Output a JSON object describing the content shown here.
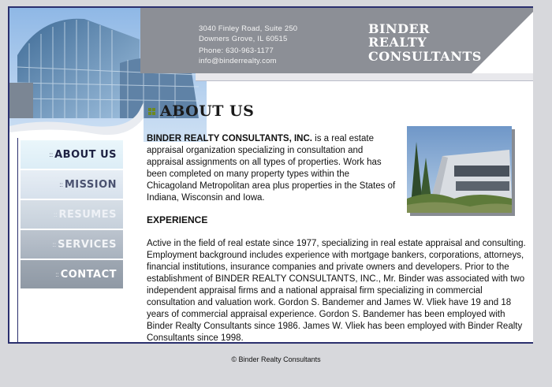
{
  "header": {
    "address_line1": "3040 Finley Road, Suite 250",
    "address_line2": "Downers Grove, IL 60515",
    "phone": "Phone: 630-963-1177",
    "email": "info@binderrealty.com",
    "logo_lines": [
      "BINDER",
      "REALTY",
      "CONSULTANTS"
    ]
  },
  "nav": {
    "items": [
      {
        "label": "ABOUT US"
      },
      {
        "label": "MISSION"
      },
      {
        "label": "RESUMES"
      },
      {
        "label": "SERVICES"
      },
      {
        "label": "CONTACT"
      }
    ],
    "bullet": "::"
  },
  "main": {
    "title": "ABOUT US",
    "intro_company": "BINDER REALTY CONSULTANTS, INC.",
    "intro_text": " is a real estate appraisal organization specializing in consultation and appraisal assignments on all types of properties. Work has been completed on many property types within the Chicagoland Metropolitan area plus properties in the States of Indiana, Wisconsin and Iowa.",
    "experience_heading": "EXPERIENCE",
    "experience_text": "Active in the field of real estate since 1977, specializing in real estate appraisal and consulting. Employment background includes experience with mortgage bankers, corporations, attorneys, financial institutions, insurance companies and private owners and developers. Prior to the establishment of BINDER REALTY CONSULTANTS, INC., Mr. Binder was associated with two independent appraisal firms and a national appraisal firm specializing in commercial consultation and valuation work. Gordon S. Bandemer and James W. Vliek have 19 and 18 years of commercial appraisal experience. Gordon S. Bandemer has been employed with Binder Realty Consultants since 1986. James W. Vliek has been employed with Binder Realty Consultants since 1998."
  },
  "footer": {
    "text": "© Binder Realty Consultants"
  },
  "colors": {
    "frame": "#2a2f6e",
    "header_band": "#8c8f96",
    "title_bullet": "#6d8a1d"
  }
}
